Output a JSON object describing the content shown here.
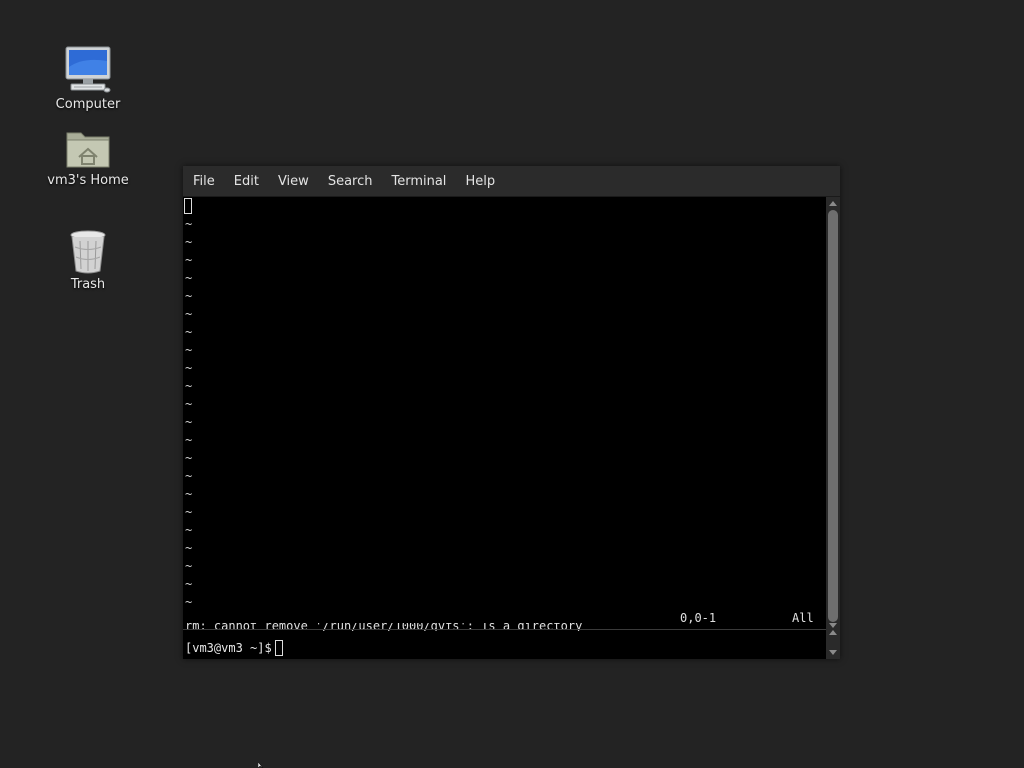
{
  "desktop": {
    "icons": [
      {
        "label": "Computer",
        "icon": "computer-icon"
      },
      {
        "label": "vm3's Home",
        "icon": "home-folder-icon"
      },
      {
        "label": "Trash",
        "icon": "trash-icon"
      }
    ]
  },
  "terminal": {
    "menu": [
      "File",
      "Edit",
      "View",
      "Search",
      "Terminal",
      "Help"
    ],
    "tilde": "~",
    "ruler_position": "0,0-1",
    "ruler_scope": "All",
    "error_line": "rm: cannot remove '/run/user/1000/gvfs': Is a directory",
    "prompt": "[vm3@vm3 ~]$"
  },
  "colors": {
    "desktop_bg": "#232323",
    "menubar_bg": "#2b2b2b",
    "terminal_bg": "#000000"
  }
}
